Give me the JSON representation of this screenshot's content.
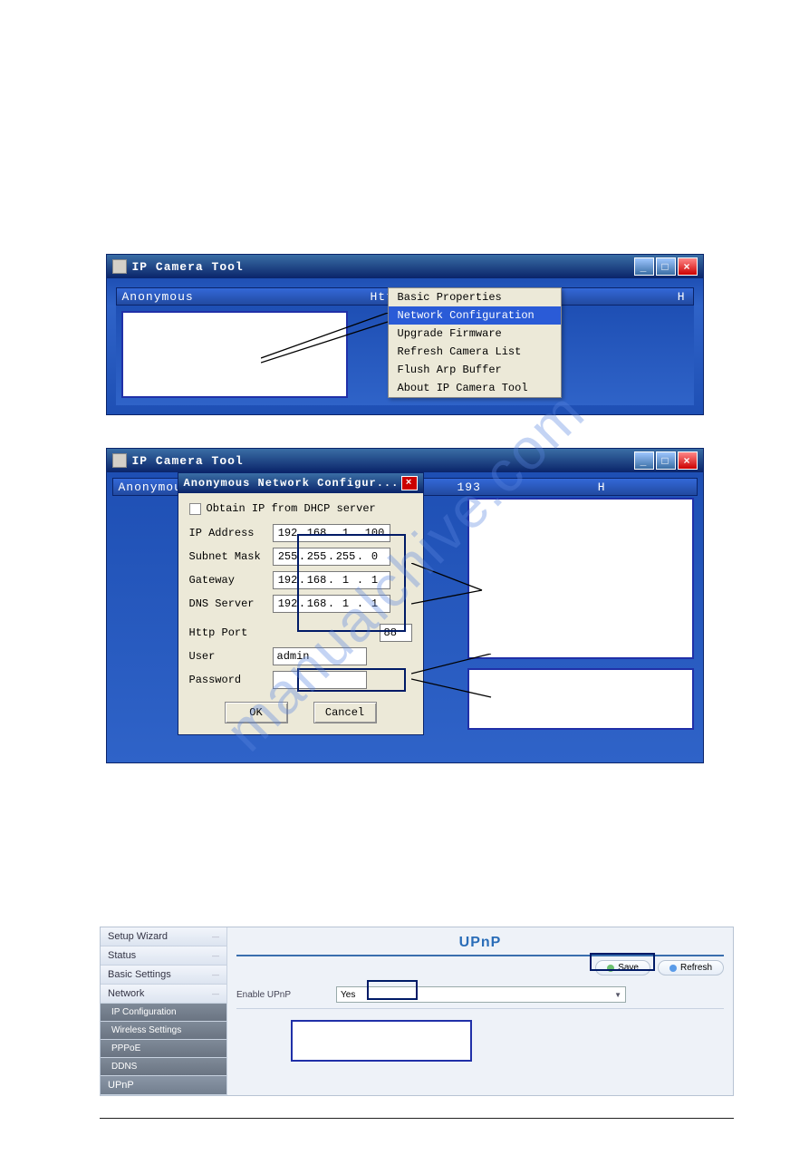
{
  "window1": {
    "title": "IP Camera Tool",
    "header_left": "Anonymous",
    "header_center": "Http://",
    "header_right": "H",
    "menu": {
      "items": [
        "Basic Properties",
        "Network Configuration",
        "Upgrade Firmware",
        "Refresh Camera List",
        "Flush Arp Buffer",
        "About IP Camera Tool"
      ],
      "selected_index": 1
    }
  },
  "window2": {
    "title": "IP Camera Tool",
    "header_left": "Anonymou",
    "header_num": "193",
    "header_right": "H",
    "dialog": {
      "title": "Anonymous Network Configur...",
      "dhcp_label": "Obtain IP from DHCP server",
      "rows": {
        "ip_label": "IP Address",
        "ip_value": [
          "192",
          "168",
          "1",
          "100"
        ],
        "mask_label": "Subnet Mask",
        "mask_value": [
          "255",
          "255",
          "255",
          "0"
        ],
        "gw_label": "Gateway",
        "gw_value": [
          "192",
          "168",
          "1",
          "1"
        ],
        "dns_label": "DNS Server",
        "dns_value": [
          "192",
          "168",
          "1",
          "1"
        ],
        "port_label": "Http Port",
        "port_value": "88",
        "user_label": "User",
        "user_value": "admin",
        "pwd_label": "Password",
        "pwd_value": ""
      },
      "ok": "OK",
      "cancel": "Cancel"
    }
  },
  "watermark": "manualchive.com",
  "upnp": {
    "title": "UPnP",
    "sidebar": [
      {
        "label": "Setup Wizard",
        "cls": "light"
      },
      {
        "label": "Status",
        "cls": "light"
      },
      {
        "label": "Basic Settings",
        "cls": "light"
      },
      {
        "label": "Network",
        "cls": "light"
      },
      {
        "label": "IP Configuration",
        "cls": "dark"
      },
      {
        "label": "Wireless Settings",
        "cls": "dark"
      },
      {
        "label": "PPPoE",
        "cls": "dark"
      },
      {
        "label": "DDNS",
        "cls": "dark"
      },
      {
        "label": "UPnP",
        "cls": "sel"
      }
    ],
    "save": "Save",
    "refresh": "Refresh",
    "enable_label": "Enable UPnP",
    "enable_value": "Yes"
  }
}
